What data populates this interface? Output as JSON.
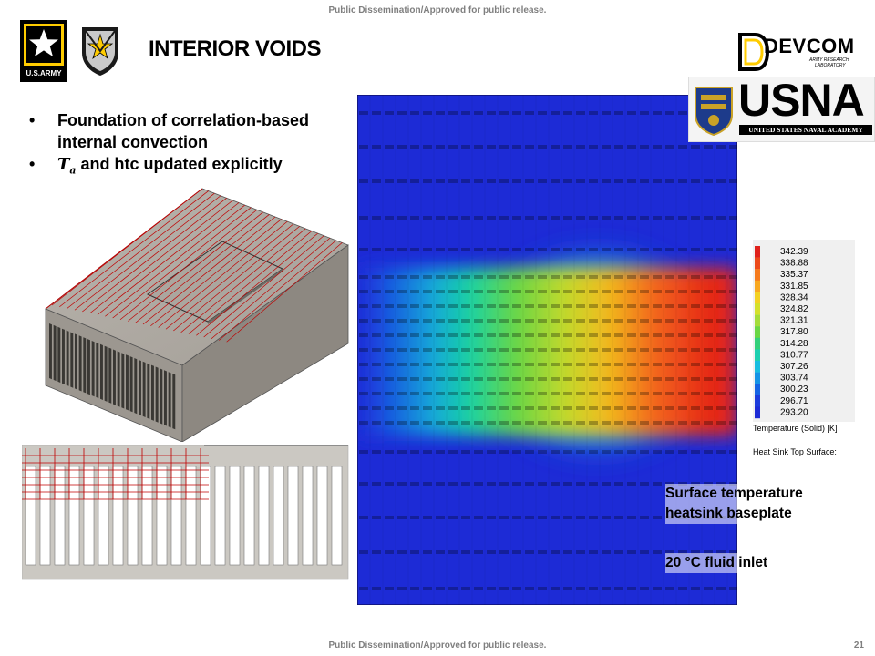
{
  "header": {
    "banner": "Public Dissemination/Approved for public release."
  },
  "footer": {
    "banner": "Public Dissemination/Approved for public release.",
    "page_number": "21"
  },
  "logos": {
    "army": "U.S.ARMY",
    "devcom": "DEVCOM",
    "devcom_sub1": "ARMY RESEARCH",
    "devcom_sub2": "LABORATORY",
    "usna": "USNA",
    "usna_sub": "UNITED STATES NAVAL ACADEMY"
  },
  "slide": {
    "title": "INTERIOR VOIDS",
    "bullets": [
      {
        "text": "Foundation of correlation-based internal  convection"
      },
      {
        "symbol": "T",
        "subscript": "a",
        "text": " and htc updated explicitly"
      }
    ]
  },
  "legend": {
    "values": [
      "342.39",
      "338.88",
      "335.37",
      "331.85",
      "328.34",
      "324.82",
      "321.31",
      "317.80",
      "314.28",
      "310.77",
      "307.26",
      "303.74",
      "300.23",
      "296.71",
      "293.20"
    ],
    "min": 293.2,
    "max": 342.39,
    "title": "Temperature (Solid) [K]",
    "subtitle": "Heat Sink Top Surface:"
  },
  "callouts": {
    "surface_line1": "Surface temperature",
    "surface_line2": "heatsink baseplate",
    "inlet": "20 °C fluid inlet"
  },
  "colors": {
    "banner_gray": "#7f7f7f",
    "mesh_red": "#c00000",
    "contour_low": "#1a2bd8",
    "contour_high": "#e8231a"
  }
}
